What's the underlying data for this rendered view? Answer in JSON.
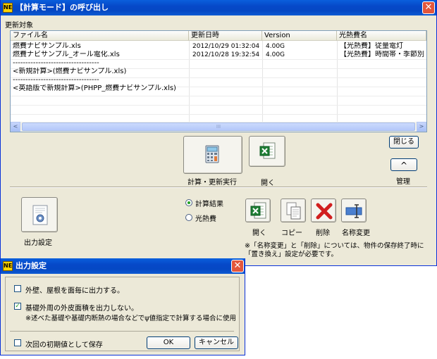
{
  "main_window": {
    "title": "【計算モード】の呼び出し",
    "close_label": "✕",
    "section_label": "更新対象",
    "columns": [
      "ファイル名",
      "更新日時",
      "Version",
      "光熱費名"
    ],
    "rows": [
      [
        "燃費ナビサンプル.xls",
        "2012/10/29 01:32:04",
        "4.00G",
        "【光熱費】従量電灯"
      ],
      [
        "燃費ナビサンプル_オール電化.xls",
        "2012/10/28 19:32:54",
        "4.00G",
        "【光熱費】時間帯・季節別"
      ],
      [
        "----------------------------------",
        "",
        "",
        ""
      ],
      [
        "<新規計算>(燃費ナビサンプル.xls)",
        "",
        "",
        ""
      ],
      [
        "----------------------------------",
        "",
        "",
        ""
      ],
      [
        "<英語版で新規計算>(PHPP_燃費ナビサンプル.xls)",
        "",
        "",
        ""
      ]
    ],
    "scroll_left": "<",
    "scroll_right": ">",
    "scroll_grip": "III",
    "calc_run_label": "計算・更新実行",
    "open_label": "開く",
    "close_button_label": "閉じる",
    "collapse_glyph": "^",
    "manage_label": "管理",
    "output_settings_label": "出力設定",
    "radio_calc_result": "計算結果",
    "radio_utility": "光熱費",
    "action_open": "開く",
    "action_copy": "コピー",
    "action_delete": "削除",
    "action_rename": "名称変更",
    "note_line1": "※「名称変更」と「削除」については、物件の保存終了時に",
    "note_line2": "「置き換え」設定が必要です。"
  },
  "output_dialog": {
    "title": "出力設定",
    "close_label": "✕",
    "opt_exterior_walls": "外壁、屋根を面毎に出力する。",
    "opt_exterior_walls_checked": false,
    "opt_foundation": "基礎外周の外皮面積を出力しない。",
    "opt_foundation_checked": true,
    "opt_foundation_note": "※述べた基礎や基礎内断熱の場合などでψ値指定で計算する場合に使用",
    "save_default": "次回の初期値として保存",
    "save_default_checked": false,
    "ok_label": "OK",
    "cancel_label": "キャンセル",
    "check_glyph": "✓"
  }
}
